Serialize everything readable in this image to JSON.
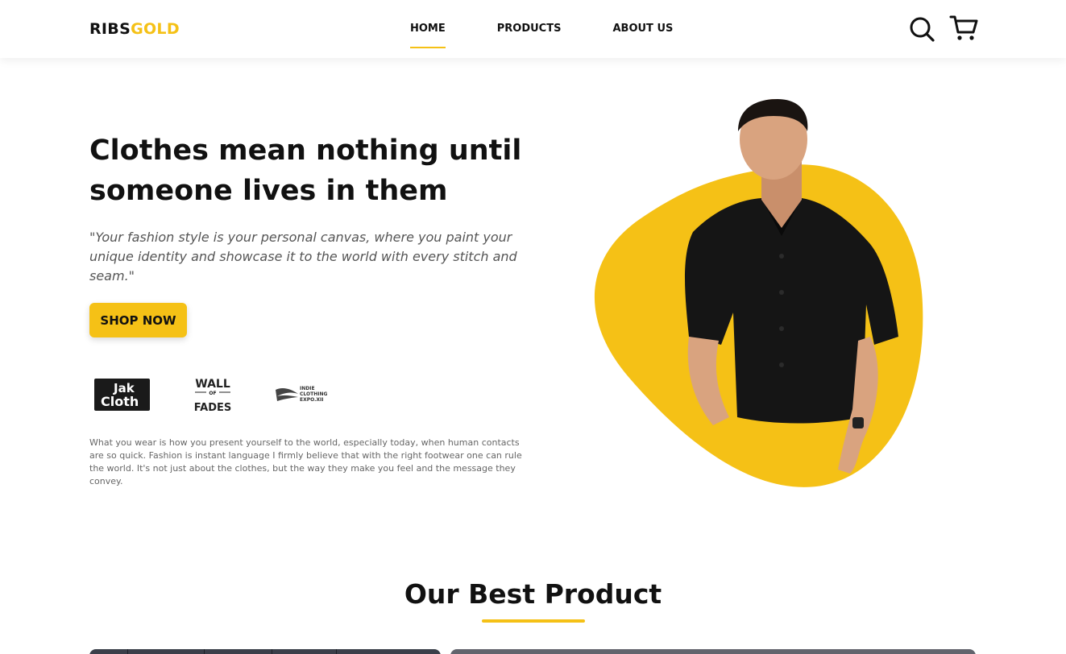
{
  "header": {
    "logo_part1": "RIBS",
    "logo_part2": "GOLD",
    "nav": [
      {
        "label": "HOME",
        "active": true
      },
      {
        "label": "PRODUCTS",
        "active": false
      },
      {
        "label": "ABOUT US",
        "active": false
      }
    ],
    "icons": [
      "search-icon",
      "cart-icon"
    ]
  },
  "hero": {
    "title": "Clothes mean nothing until someone lives in them",
    "quote": "\"Your fashion style is your personal canvas, where you paint your unique identity and showcase it to the world with every stitch and seam.\"",
    "cta_label": "SHOP NOW",
    "partners": {
      "jak": [
        "Jak",
        "Cloth"
      ],
      "wall": [
        "WALL",
        "OF",
        "FADES"
      ],
      "indie": [
        "INDIE",
        "CLOTHING",
        "EXPO.XII"
      ]
    },
    "description": "What you wear is how you present yourself to the world, especially today, when human contacts are so quick. Fashion is instant language I firmly believe that with the right footwear one can rule the world. It's not just about the clothes, but the way they make you feel and the message they convey."
  },
  "best_product": {
    "title": "Our Best Product"
  },
  "colors": {
    "accent": "#f5c116",
    "text": "#111111",
    "muted": "#666666"
  }
}
